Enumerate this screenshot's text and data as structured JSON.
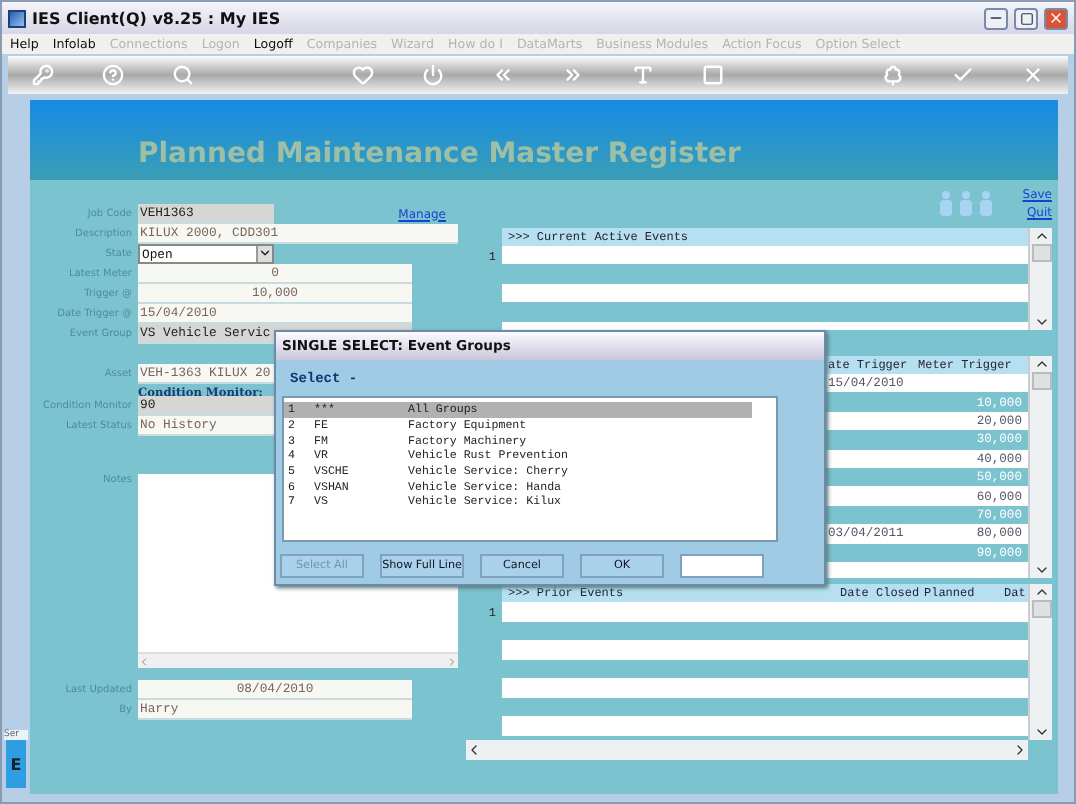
{
  "window": {
    "title": "IES Client(Q) v8.25 : My IES"
  },
  "menu": [
    {
      "label": "Help",
      "disabled": false
    },
    {
      "label": "Infolab",
      "disabled": false
    },
    {
      "label": "Connections",
      "disabled": true
    },
    {
      "label": "Logon",
      "disabled": true
    },
    {
      "label": "Logoff",
      "disabled": false
    },
    {
      "label": "Companies",
      "disabled": true
    },
    {
      "label": "Wizard",
      "disabled": true
    },
    {
      "label": "How do I",
      "disabled": true
    },
    {
      "label": "DataMarts",
      "disabled": true
    },
    {
      "label": "Business Modules",
      "disabled": true
    },
    {
      "label": "Action Focus",
      "disabled": true
    },
    {
      "label": "Option Select",
      "disabled": true
    }
  ],
  "page_title": "Planned Maintenance Master Register",
  "manage_link": "Manage",
  "links": [
    "Save",
    "Quit"
  ],
  "fields": [
    {
      "kind": "text",
      "label": "Job Code",
      "value": "VEH1363",
      "readonly": true
    },
    {
      "kind": "text",
      "label": "Description",
      "value": "KILUX 2000, CDD301",
      "readonly": false
    },
    {
      "kind": "dropdown",
      "label": "State",
      "value": "Open"
    },
    {
      "kind": "number",
      "label": "Latest Meter",
      "value": "0",
      "readonly": false
    },
    {
      "kind": "number",
      "label": "Trigger @",
      "value": "10,000",
      "readonly": false
    },
    {
      "kind": "text",
      "label": "Date Trigger @",
      "value": "15/04/2010",
      "readonly": false
    },
    {
      "kind": "text",
      "label": "Event Group",
      "value": "VS Vehicle Servic",
      "readonly": true
    },
    {
      "kind": "text",
      "label": "Asset",
      "value": "VEH-1363 KILUX 20",
      "readonly": false
    },
    {
      "kind": "heading",
      "label": "Condition Monitor:"
    },
    {
      "kind": "text",
      "label": "Condition Monitor",
      "value": "90",
      "readonly": true
    },
    {
      "kind": "text",
      "label": "Latest Status",
      "value": "No History",
      "readonly": false
    },
    {
      "kind": "textarea",
      "label": "Notes"
    },
    {
      "kind": "number",
      "label": "Last Updated",
      "value": "08/04/2010",
      "readonly": false
    },
    {
      "kind": "text",
      "label": "By",
      "value": "Harry",
      "readonly": false
    }
  ],
  "current_events": {
    "header": ">>> Current Active Events",
    "row_number": "1"
  },
  "triggers": {
    "columns": [
      "ate Trigger",
      "Meter Trigger"
    ],
    "rows": [
      [
        "15/04/2010",
        ""
      ],
      [
        "",
        "10,000"
      ],
      [
        "",
        "20,000"
      ],
      [
        "",
        "30,000"
      ],
      [
        "",
        "40,000"
      ],
      [
        "",
        "50,000"
      ],
      [
        "",
        "60,000"
      ],
      [
        "",
        "70,000"
      ],
      [
        "03/04/2011",
        "80,000"
      ],
      [
        "",
        "90,000"
      ]
    ]
  },
  "prior_events": {
    "columns": [
      ">>> Prior Events",
      "Date Closed",
      "Planned",
      "Dat"
    ],
    "row_number": "1"
  },
  "side_tab": {
    "label": "Ser",
    "button": "E"
  },
  "dialog": {
    "title": "SINGLE SELECT: Event Groups",
    "prompt": "Select -",
    "items": [
      {
        "number": "1",
        "code": "***",
        "name": "All Groups",
        "selected": true
      },
      {
        "number": "2",
        "code": "FE",
        "name": "Factory Equipment",
        "selected": false
      },
      {
        "number": "3",
        "code": "FM",
        "name": "Factory Machinery",
        "selected": false
      },
      {
        "number": "4",
        "code": "VR",
        "name": "Vehicle Rust Prevention",
        "selected": false
      },
      {
        "number": "5",
        "code": "VSCHE",
        "name": "Vehicle Service: Cherry",
        "selected": false
      },
      {
        "number": "6",
        "code": "VSHAN",
        "name": "Vehicle Service: Handa",
        "selected": false
      },
      {
        "number": "7",
        "code": "VS",
        "name": "Vehicle Service: Kilux",
        "selected": false
      }
    ],
    "buttons": [
      {
        "label": "Select All",
        "disabled": true
      },
      {
        "label": "Show Full Line",
        "disabled": false
      },
      {
        "label": "Cancel",
        "disabled": false
      },
      {
        "label": "OK",
        "disabled": false
      }
    ]
  }
}
